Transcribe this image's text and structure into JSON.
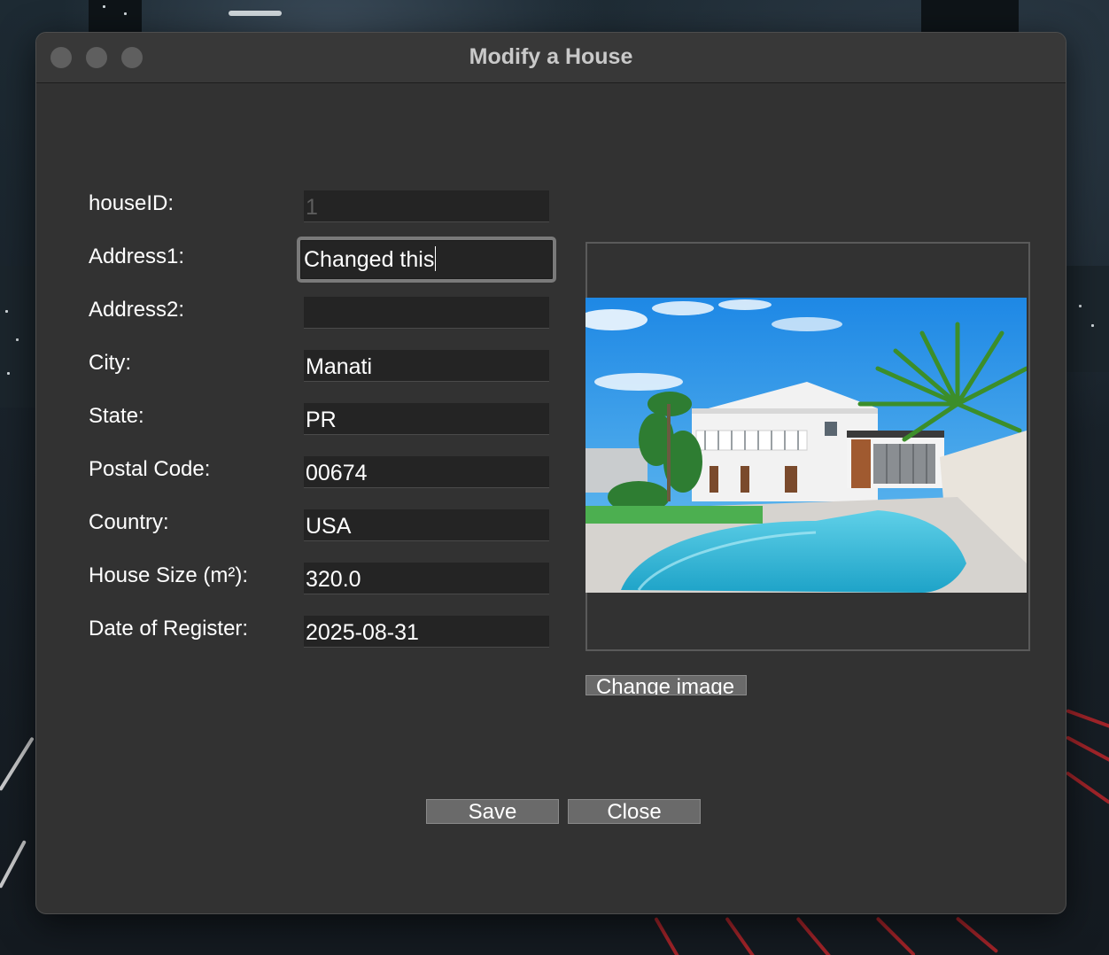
{
  "window": {
    "title": "Modify a House"
  },
  "form": {
    "fields": [
      {
        "label": "houseID:",
        "value": "1",
        "disabled": true
      },
      {
        "label": "Address1:",
        "value": "Changed this",
        "focused": true
      },
      {
        "label": "Address2:",
        "value": ""
      },
      {
        "label": "City:",
        "value": "Manati"
      },
      {
        "label": "State:",
        "value": "PR"
      },
      {
        "label": "Postal Code:",
        "value": "00674"
      },
      {
        "label": "Country:",
        "value": "USA"
      },
      {
        "label": "House Size (m²):",
        "value": "320.0"
      },
      {
        "label": "Date of Register:",
        "value": "2025-08-31"
      }
    ]
  },
  "image_panel": {
    "change_image_label": "Change image"
  },
  "buttons": {
    "save_label": "Save",
    "close_label": "Close"
  },
  "colors": {
    "window_bg": "#323232",
    "field_bg": "#242424",
    "button_bg": "#6a6a6a",
    "traffic_light": "#5f5f5f"
  }
}
